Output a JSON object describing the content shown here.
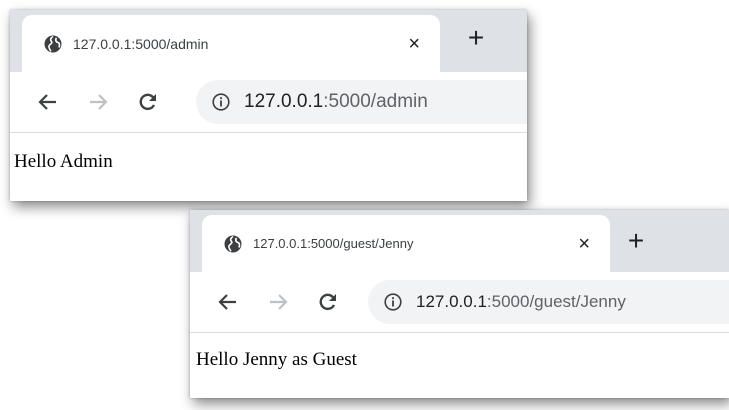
{
  "windows": [
    {
      "tab": {
        "title": "127.0.0.1:5000/admin",
        "close_glyph": "×",
        "favicon": "globe-icon"
      },
      "new_tab_glyph": "+",
      "nav": {
        "back": "back-arrow-icon",
        "forward": "forward-arrow-icon",
        "reload": "reload-icon"
      },
      "address": {
        "host": "127.0.0.1",
        "rest": ":5000/admin",
        "security_icon": "info-icon"
      },
      "page_text": "Hello Admin"
    },
    {
      "tab": {
        "title": "127.0.0.1:5000/guest/Jenny",
        "close_glyph": "×",
        "favicon": "globe-icon"
      },
      "new_tab_glyph": "+",
      "nav": {
        "back": "back-arrow-icon",
        "forward": "forward-arrow-icon",
        "reload": "reload-icon"
      },
      "address": {
        "host": "127.0.0.1",
        "rest": ":5000/guest/Jenny",
        "security_icon": "info-icon"
      },
      "page_text": "Hello Jenny as Guest"
    }
  ],
  "colors": {
    "tabstrip": "#dee1e6",
    "omnibox": "#f1f3f4",
    "icon": "#5f6368",
    "icon_disabled": "#bdc1c6",
    "text_dark": "#202124"
  }
}
